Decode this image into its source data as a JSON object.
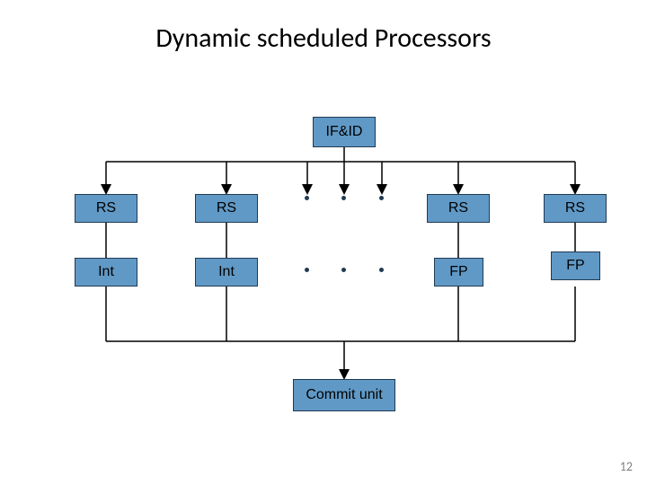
{
  "title": "Dynamic scheduled Processors",
  "ifid": "IF&ID",
  "rs": "RS",
  "int": "Int",
  "fp": "FP",
  "commit": "Commit unit",
  "page": "12"
}
